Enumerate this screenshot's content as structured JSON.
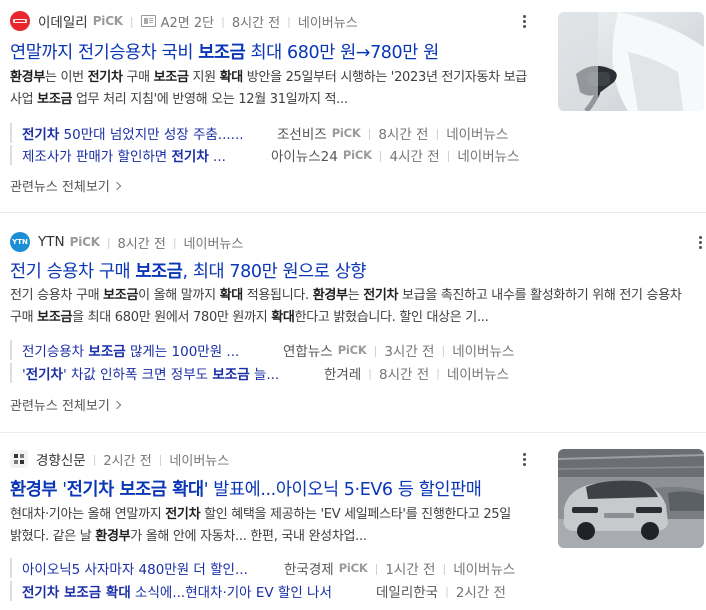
{
  "colors": {
    "title": "#0a36b8",
    "related": "#1a2ea8",
    "divider": "#e9eaee"
  },
  "articles": [
    {
      "press": "이데일리",
      "pick": "PiCK",
      "logo_text": "이데일리",
      "paper": "A2면 2단",
      "time": "8시간 전",
      "portal": "네이버뉴스",
      "title_parts": [
        "연말까지 전기승용차 국비 ",
        "보조금",
        " 최대 680만 원→780만 원"
      ],
      "desc": [
        "환경부",
        "는 이번 ",
        "전기차",
        " 구매 ",
        "보조금",
        " 지원 ",
        "확대",
        " 방안을 25일부터 시행하는 '2023년 전기자동차 보급 사업 ",
        "보조금",
        " 업무 처리 지침'에 반영해 오는 12월 31일까지 적..."
      ],
      "related": [
        {
          "title_parts": [
            "전기차",
            " 50만대 넘었지만 성장 주춤......"
          ],
          "press": "조선비즈",
          "pick": "PiCK",
          "time": "8시간 전",
          "portal": "네이버뉴스"
        },
        {
          "title_parts": [
            "제조사가 판매가 할인하면 ",
            "전기차",
            " ..."
          ],
          "press": "아이뉴스24",
          "pick": "PiCK",
          "time": "4시간 전",
          "portal": "네이버뉴스"
        }
      ],
      "more": "관련뉴스 전체보기",
      "thumb_icon": "car-charging-photo"
    },
    {
      "press": "YTN",
      "pick": "PiCK",
      "logo_text": "YTN",
      "time": "8시간 전",
      "portal": "네이버뉴스",
      "title_parts": [
        "전기 승용차 구매 ",
        "보조금",
        ", 최대 780만 원으로 상향"
      ],
      "desc": [
        "전기 승용차 구매 ",
        "보조금",
        "이 올해 말까지 ",
        "확대",
        " 적용됩니다. ",
        "환경부",
        "는 ",
        "전기차",
        " 보급을 촉진하고 내수를 활성화하기 위해 전기 승용차 구매 ",
        "보조금",
        "을 최대 680만 원에서 780만 원까지 ",
        "확대",
        "한다고 밝혔습니다. 할인 대상은 기..."
      ],
      "related": [
        {
          "title_parts": [
            "전기승용차 ",
            "보조금",
            " 많게는 100만원 ..."
          ],
          "press": "연합뉴스",
          "pick": "PiCK",
          "time": "3시간 전",
          "portal": "네이버뉴스"
        },
        {
          "title_parts": [
            "'",
            "전기차",
            "' 차값 인하폭 크면 정부도 ",
            "보조금",
            " 늘..."
          ],
          "press": "한겨레",
          "pick": "",
          "time": "8시간 전",
          "portal": "네이버뉴스"
        }
      ],
      "more": "관련뉴스 전체보기"
    },
    {
      "press": "경향신문",
      "time": "2시간 전",
      "portal": "네이버뉴스",
      "title_parts": [
        "환경부",
        " '",
        "전기차 보조금 확대",
        "' 발표에...아이오닉 5·EV6 등 할인판매"
      ],
      "desc": [
        "현대차·기아는 올해 연말까지 ",
        "전기차",
        " 할인 혜택을 제공하는 'EV 세일페스타'를 진행한다고 25일 밝혔다. 같은 날 ",
        "환경부",
        "가 올해 안에 자동차... 한편, 국내 완성차업..."
      ],
      "related": [
        {
          "title_parts": [
            "아이오닉5 사자마자 480만원 더 할인..."
          ],
          "press": "한국경제",
          "pick": "PiCK",
          "time": "1시간 전",
          "portal": "네이버뉴스"
        },
        {
          "title_parts": [
            "전기차 보조금 확대",
            " 소식에...현대차·기아 EV 할인 나서"
          ],
          "press": "데일리한국",
          "pick": "",
          "time": "2시간 전",
          "portal": ""
        }
      ],
      "thumb_icon": "car-factory-photo"
    }
  ]
}
